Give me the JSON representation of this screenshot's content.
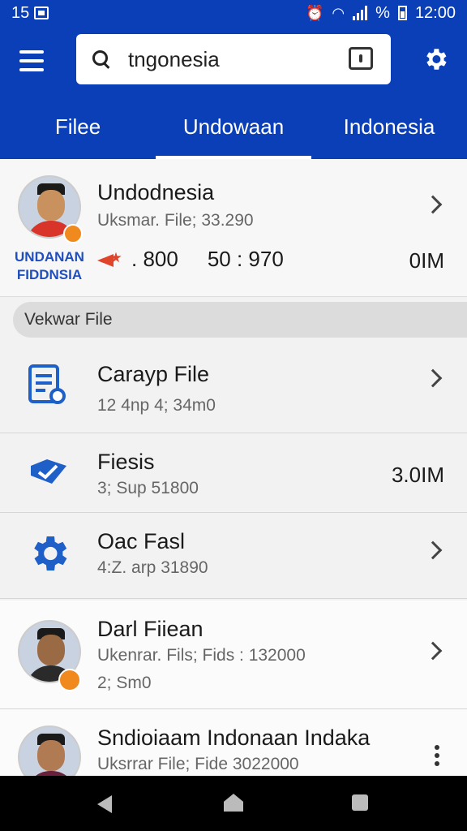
{
  "status_bar": {
    "left_number": "15",
    "time": "12:00",
    "battery_percent_label": "%"
  },
  "search": {
    "value": "tngonesia"
  },
  "tabs": [
    {
      "label": "Filee",
      "active": false
    },
    {
      "label": "Undowaan",
      "active": true
    },
    {
      "label": "Indonesia",
      "active": false
    }
  ],
  "featured": {
    "title": "Undodnesia",
    "subtitle": "Uksmar. File; 33.290",
    "org_label_line1": "UNDANAN",
    "org_label_line2": "FIDDNSIA",
    "stat1": ". 800",
    "stat2": "50 : 970",
    "size": "0IM"
  },
  "section": {
    "label": "Vekwar File"
  },
  "files": [
    {
      "title": "Carayp File",
      "subtitle": "12 4np 4; 34m0",
      "icon": "document-icon",
      "trailing": "chevron"
    },
    {
      "title": "Fiesis",
      "subtitle": "3; Sup 51800",
      "icon": "check-ticket-icon",
      "trailing": "3.0IM"
    },
    {
      "title": "Oac Fasl",
      "subtitle": "4:Z. arp 31890",
      "icon": "gear-icon",
      "trailing": "chevron"
    }
  ],
  "people": [
    {
      "title": "Darl Fiiean",
      "subtitle": "Ukenrar. Fils; Fids : 132000",
      "subtitle2": "2; Sm0",
      "trailing": "chevron"
    },
    {
      "title": "Sndioiaam Indonaan Indaka",
      "subtitle": "Uksrrar  File; Fide 3022000",
      "trailing": "kebab"
    }
  ],
  "colors": {
    "brand_blue": "#0a3fb8",
    "accent_orange": "#f08a1e",
    "icon_blue": "#1f5fc8"
  }
}
